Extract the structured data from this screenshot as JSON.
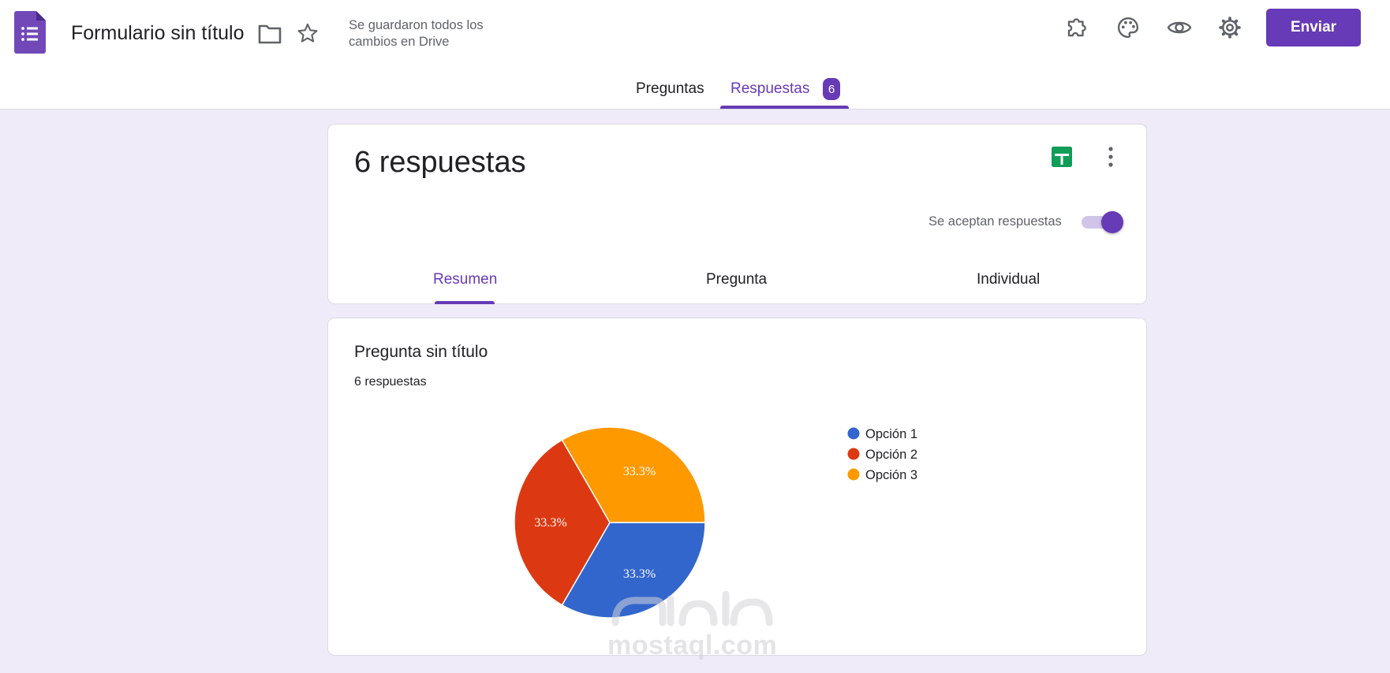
{
  "header": {
    "form_title": "Formulario sin título",
    "save_status": "Se guardaron todos los cambios en Drive",
    "send_label": "Enviar",
    "icons": [
      "forms-logo-icon",
      "folder-icon",
      "star-icon",
      "addon-icon",
      "palette-icon",
      "preview-eye-icon",
      "settings-gear-icon"
    ]
  },
  "tabs": {
    "questions_label": "Preguntas",
    "responses_label": "Respuestas",
    "responses_badge": "6",
    "active": "Respuestas"
  },
  "summary_card": {
    "title": "6 respuestas",
    "accepting_label": "Se aceptan respuestas",
    "accepting_on": true,
    "subtabs": [
      "Resumen",
      "Pregunta",
      "Individual"
    ],
    "active_subtab": "Resumen",
    "icons": [
      "sheets-icon",
      "more-vert-icon"
    ]
  },
  "question_card": {
    "title": "Pregunta sin título",
    "response_count": "6 respuestas"
  },
  "chart_data": {
    "type": "pie",
    "categories": [
      "Opción 1",
      "Opción 2",
      "Opción 3"
    ],
    "values": [
      33.3,
      33.3,
      33.3
    ],
    "labels": [
      "33.3%",
      "33.3%",
      "33.3%"
    ],
    "colors": [
      "#3366cc",
      "#dc3912",
      "#ff9900"
    ],
    "legend_position": "right"
  },
  "colors": {
    "accent": "#673ab7",
    "background": "#f0ebf8"
  },
  "watermark": "mostaql.com"
}
